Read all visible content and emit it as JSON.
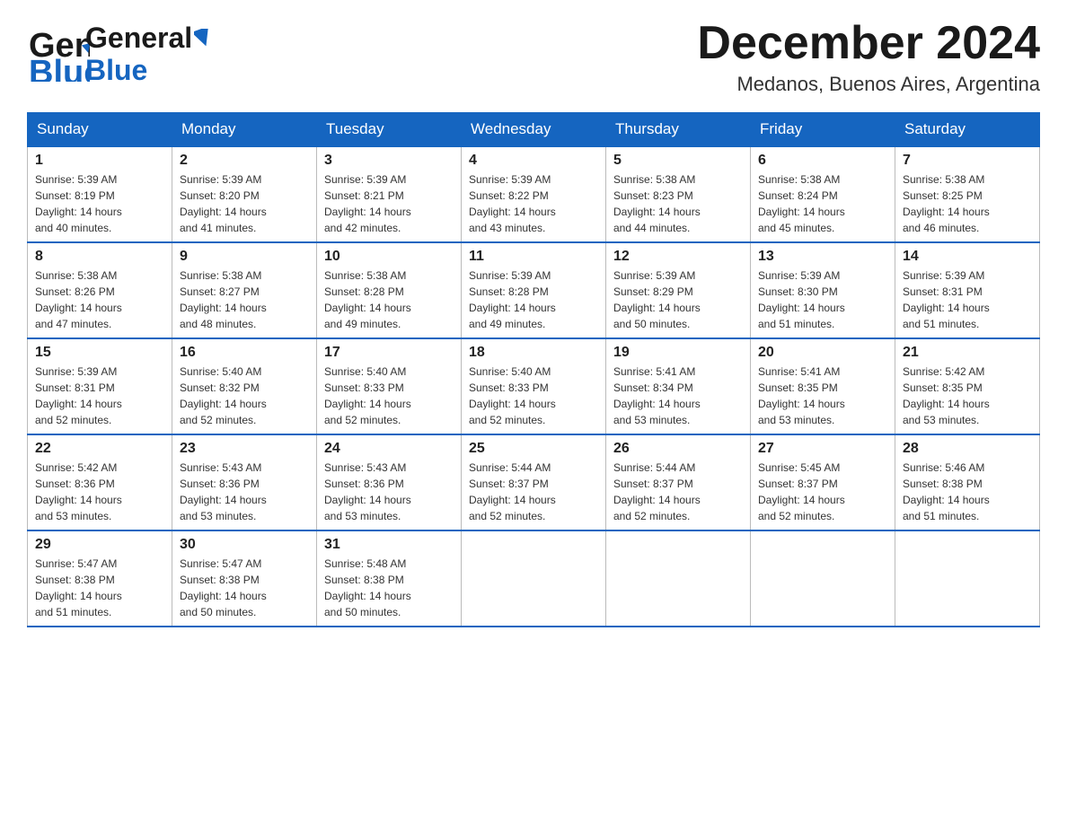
{
  "header": {
    "logo_general": "General",
    "logo_blue": "Blue",
    "month_title": "December 2024",
    "location": "Medanos, Buenos Aires, Argentina"
  },
  "calendar": {
    "days_of_week": [
      "Sunday",
      "Monday",
      "Tuesday",
      "Wednesday",
      "Thursday",
      "Friday",
      "Saturday"
    ],
    "weeks": [
      [
        {
          "day": "1",
          "sunrise": "5:39 AM",
          "sunset": "8:19 PM",
          "daylight": "14 hours and 40 minutes."
        },
        {
          "day": "2",
          "sunrise": "5:39 AM",
          "sunset": "8:20 PM",
          "daylight": "14 hours and 41 minutes."
        },
        {
          "day": "3",
          "sunrise": "5:39 AM",
          "sunset": "8:21 PM",
          "daylight": "14 hours and 42 minutes."
        },
        {
          "day": "4",
          "sunrise": "5:39 AM",
          "sunset": "8:22 PM",
          "daylight": "14 hours and 43 minutes."
        },
        {
          "day": "5",
          "sunrise": "5:38 AM",
          "sunset": "8:23 PM",
          "daylight": "14 hours and 44 minutes."
        },
        {
          "day": "6",
          "sunrise": "5:38 AM",
          "sunset": "8:24 PM",
          "daylight": "14 hours and 45 minutes."
        },
        {
          "day": "7",
          "sunrise": "5:38 AM",
          "sunset": "8:25 PM",
          "daylight": "14 hours and 46 minutes."
        }
      ],
      [
        {
          "day": "8",
          "sunrise": "5:38 AM",
          "sunset": "8:26 PM",
          "daylight": "14 hours and 47 minutes."
        },
        {
          "day": "9",
          "sunrise": "5:38 AM",
          "sunset": "8:27 PM",
          "daylight": "14 hours and 48 minutes."
        },
        {
          "day": "10",
          "sunrise": "5:38 AM",
          "sunset": "8:28 PM",
          "daylight": "14 hours and 49 minutes."
        },
        {
          "day": "11",
          "sunrise": "5:39 AM",
          "sunset": "8:28 PM",
          "daylight": "14 hours and 49 minutes."
        },
        {
          "day": "12",
          "sunrise": "5:39 AM",
          "sunset": "8:29 PM",
          "daylight": "14 hours and 50 minutes."
        },
        {
          "day": "13",
          "sunrise": "5:39 AM",
          "sunset": "8:30 PM",
          "daylight": "14 hours and 51 minutes."
        },
        {
          "day": "14",
          "sunrise": "5:39 AM",
          "sunset": "8:31 PM",
          "daylight": "14 hours and 51 minutes."
        }
      ],
      [
        {
          "day": "15",
          "sunrise": "5:39 AM",
          "sunset": "8:31 PM",
          "daylight": "14 hours and 52 minutes."
        },
        {
          "day": "16",
          "sunrise": "5:40 AM",
          "sunset": "8:32 PM",
          "daylight": "14 hours and 52 minutes."
        },
        {
          "day": "17",
          "sunrise": "5:40 AM",
          "sunset": "8:33 PM",
          "daylight": "14 hours and 52 minutes."
        },
        {
          "day": "18",
          "sunrise": "5:40 AM",
          "sunset": "8:33 PM",
          "daylight": "14 hours and 52 minutes."
        },
        {
          "day": "19",
          "sunrise": "5:41 AM",
          "sunset": "8:34 PM",
          "daylight": "14 hours and 53 minutes."
        },
        {
          "day": "20",
          "sunrise": "5:41 AM",
          "sunset": "8:35 PM",
          "daylight": "14 hours and 53 minutes."
        },
        {
          "day": "21",
          "sunrise": "5:42 AM",
          "sunset": "8:35 PM",
          "daylight": "14 hours and 53 minutes."
        }
      ],
      [
        {
          "day": "22",
          "sunrise": "5:42 AM",
          "sunset": "8:36 PM",
          "daylight": "14 hours and 53 minutes."
        },
        {
          "day": "23",
          "sunrise": "5:43 AM",
          "sunset": "8:36 PM",
          "daylight": "14 hours and 53 minutes."
        },
        {
          "day": "24",
          "sunrise": "5:43 AM",
          "sunset": "8:36 PM",
          "daylight": "14 hours and 53 minutes."
        },
        {
          "day": "25",
          "sunrise": "5:44 AM",
          "sunset": "8:37 PM",
          "daylight": "14 hours and 52 minutes."
        },
        {
          "day": "26",
          "sunrise": "5:44 AM",
          "sunset": "8:37 PM",
          "daylight": "14 hours and 52 minutes."
        },
        {
          "day": "27",
          "sunrise": "5:45 AM",
          "sunset": "8:37 PM",
          "daylight": "14 hours and 52 minutes."
        },
        {
          "day": "28",
          "sunrise": "5:46 AM",
          "sunset": "8:38 PM",
          "daylight": "14 hours and 51 minutes."
        }
      ],
      [
        {
          "day": "29",
          "sunrise": "5:47 AM",
          "sunset": "8:38 PM",
          "daylight": "14 hours and 51 minutes."
        },
        {
          "day": "30",
          "sunrise": "5:47 AM",
          "sunset": "8:38 PM",
          "daylight": "14 hours and 50 minutes."
        },
        {
          "day": "31",
          "sunrise": "5:48 AM",
          "sunset": "8:38 PM",
          "daylight": "14 hours and 50 minutes."
        },
        null,
        null,
        null,
        null
      ]
    ]
  }
}
